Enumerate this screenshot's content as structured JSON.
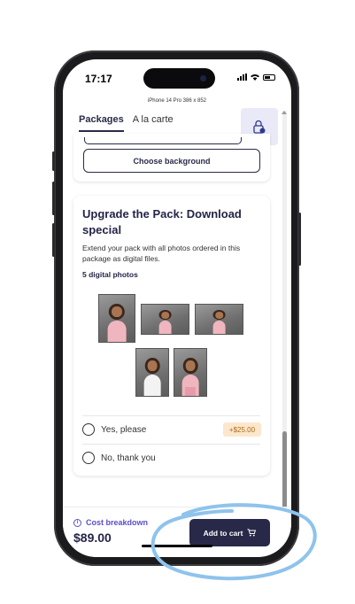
{
  "status_bar": {
    "time": "17:17"
  },
  "device_label": "iPhone 14 Pro  386 x 852",
  "tabs": [
    {
      "label": "Packages",
      "active": true
    },
    {
      "label": "A la carte",
      "active": false
    }
  ],
  "icons": {
    "lock_button": "lock-badge-icon",
    "cart": "cart-icon",
    "info": "info-icon"
  },
  "top_card": {
    "choose_background_label": "Choose background"
  },
  "upgrade_card": {
    "title": "Upgrade the Pack: Download special",
    "description": "Extend your pack with all photos ordered in this package as digital files.",
    "photo_count_label": "5 digital photos",
    "photos": [
      "photo-1",
      "photo-2",
      "photo-3",
      "photo-4",
      "photo-5"
    ],
    "options": [
      {
        "label": "Yes, please",
        "price": "+$25.00"
      },
      {
        "label": "No, thank you"
      }
    ]
  },
  "bottom_bar": {
    "cost_breakdown_label": "Cost breakdown",
    "total": "$89.00",
    "add_to_cart_label": "Add to cart"
  },
  "colors": {
    "accent": "#282848",
    "link": "#5a4ec9",
    "price_badge_bg": "#fde7cc",
    "annotation_oval": "#8ec3ec"
  }
}
